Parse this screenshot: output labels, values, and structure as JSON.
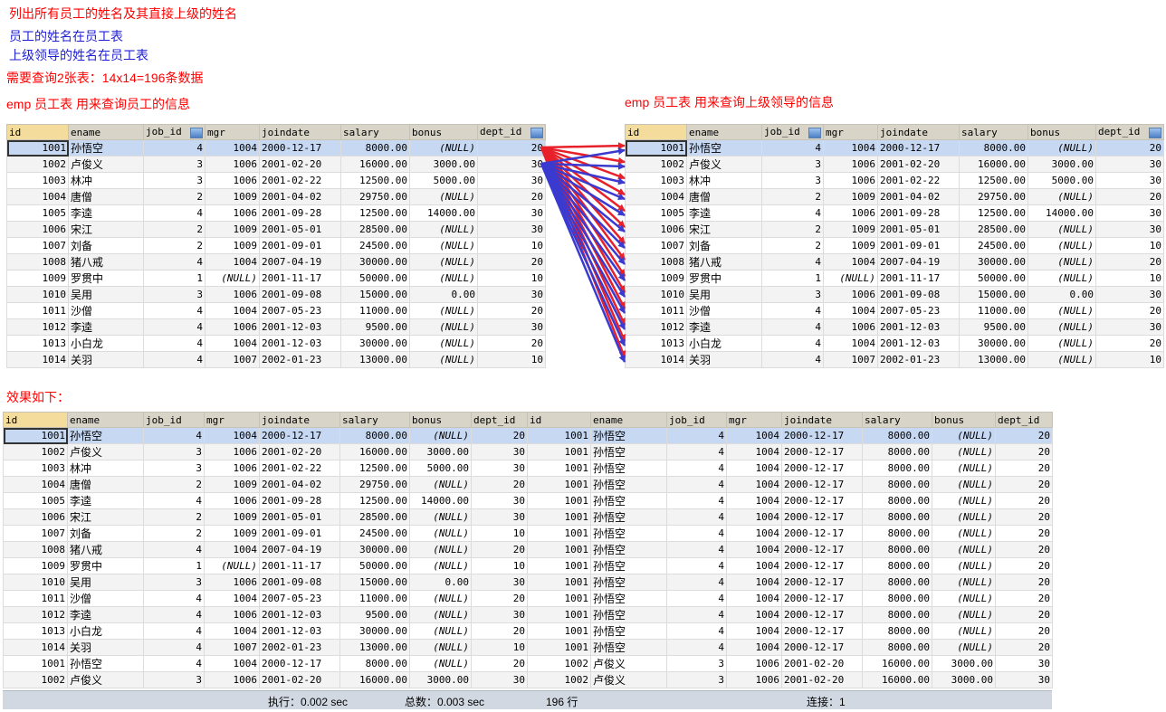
{
  "notes": {
    "line1": "列出所有员工的姓名及其直接上级的姓名",
    "line2": "员工的姓名在员工表",
    "line3": "上级领导的姓名在员工表",
    "line4": "需要查询2张表：14x14=196条数据",
    "left_caption": "emp 员工表  用来查询员工的信息",
    "right_caption": "emp 员工表  用来查询上级领导的信息",
    "result_caption": "效果如下："
  },
  "columns": [
    "id",
    "ename",
    "job_id",
    "mgr",
    "joindate",
    "salary",
    "bonus",
    "dept_id"
  ],
  "emp_rows": [
    [
      "1001",
      "孙悟空",
      "4",
      "1004",
      "2000-12-17",
      "8000.00",
      "(NULL)",
      "20"
    ],
    [
      "1002",
      "卢俊义",
      "3",
      "1006",
      "2001-02-20",
      "16000.00",
      "3000.00",
      "30"
    ],
    [
      "1003",
      "林冲",
      "3",
      "1006",
      "2001-02-22",
      "12500.00",
      "5000.00",
      "30"
    ],
    [
      "1004",
      "唐僧",
      "2",
      "1009",
      "2001-04-02",
      "29750.00",
      "(NULL)",
      "20"
    ],
    [
      "1005",
      "李逵",
      "4",
      "1006",
      "2001-09-28",
      "12500.00",
      "14000.00",
      "30"
    ],
    [
      "1006",
      "宋江",
      "2",
      "1009",
      "2001-05-01",
      "28500.00",
      "(NULL)",
      "30"
    ],
    [
      "1007",
      "刘备",
      "2",
      "1009",
      "2001-09-01",
      "24500.00",
      "(NULL)",
      "10"
    ],
    [
      "1008",
      "猪八戒",
      "4",
      "1004",
      "2007-04-19",
      "30000.00",
      "(NULL)",
      "20"
    ],
    [
      "1009",
      "罗贯中",
      "1",
      "(NULL)",
      "2001-11-17",
      "50000.00",
      "(NULL)",
      "10"
    ],
    [
      "1010",
      "吴用",
      "3",
      "1006",
      "2001-09-08",
      "15000.00",
      "0.00",
      "30"
    ],
    [
      "1011",
      "沙僧",
      "4",
      "1004",
      "2007-05-23",
      "11000.00",
      "(NULL)",
      "20"
    ],
    [
      "1012",
      "李逵",
      "4",
      "1006",
      "2001-12-03",
      "9500.00",
      "(NULL)",
      "30"
    ],
    [
      "1013",
      "小白龙",
      "4",
      "1004",
      "2001-12-03",
      "30000.00",
      "(NULL)",
      "20"
    ],
    [
      "1014",
      "关羽",
      "4",
      "1007",
      "2002-01-23",
      "13000.00",
      "(NULL)",
      "10"
    ]
  ],
  "result_rows": [
    [
      "1001",
      "孙悟空",
      "4",
      "1004",
      "2000-12-17",
      "8000.00",
      "(NULL)",
      "20",
      "1001",
      "孙悟空",
      "4",
      "1004",
      "2000-12-17",
      "8000.00",
      "(NULL)",
      "20"
    ],
    [
      "1002",
      "卢俊义",
      "3",
      "1006",
      "2001-02-20",
      "16000.00",
      "3000.00",
      "30",
      "1001",
      "孙悟空",
      "4",
      "1004",
      "2000-12-17",
      "8000.00",
      "(NULL)",
      "20"
    ],
    [
      "1003",
      "林冲",
      "3",
      "1006",
      "2001-02-22",
      "12500.00",
      "5000.00",
      "30",
      "1001",
      "孙悟空",
      "4",
      "1004",
      "2000-12-17",
      "8000.00",
      "(NULL)",
      "20"
    ],
    [
      "1004",
      "唐僧",
      "2",
      "1009",
      "2001-04-02",
      "29750.00",
      "(NULL)",
      "20",
      "1001",
      "孙悟空",
      "4",
      "1004",
      "2000-12-17",
      "8000.00",
      "(NULL)",
      "20"
    ],
    [
      "1005",
      "李逵",
      "4",
      "1006",
      "2001-09-28",
      "12500.00",
      "14000.00",
      "30",
      "1001",
      "孙悟空",
      "4",
      "1004",
      "2000-12-17",
      "8000.00",
      "(NULL)",
      "20"
    ],
    [
      "1006",
      "宋江",
      "2",
      "1009",
      "2001-05-01",
      "28500.00",
      "(NULL)",
      "30",
      "1001",
      "孙悟空",
      "4",
      "1004",
      "2000-12-17",
      "8000.00",
      "(NULL)",
      "20"
    ],
    [
      "1007",
      "刘备",
      "2",
      "1009",
      "2001-09-01",
      "24500.00",
      "(NULL)",
      "10",
      "1001",
      "孙悟空",
      "4",
      "1004",
      "2000-12-17",
      "8000.00",
      "(NULL)",
      "20"
    ],
    [
      "1008",
      "猪八戒",
      "4",
      "1004",
      "2007-04-19",
      "30000.00",
      "(NULL)",
      "20",
      "1001",
      "孙悟空",
      "4",
      "1004",
      "2000-12-17",
      "8000.00",
      "(NULL)",
      "20"
    ],
    [
      "1009",
      "罗贯中",
      "1",
      "(NULL)",
      "2001-11-17",
      "50000.00",
      "(NULL)",
      "10",
      "1001",
      "孙悟空",
      "4",
      "1004",
      "2000-12-17",
      "8000.00",
      "(NULL)",
      "20"
    ],
    [
      "1010",
      "吴用",
      "3",
      "1006",
      "2001-09-08",
      "15000.00",
      "0.00",
      "30",
      "1001",
      "孙悟空",
      "4",
      "1004",
      "2000-12-17",
      "8000.00",
      "(NULL)",
      "20"
    ],
    [
      "1011",
      "沙僧",
      "4",
      "1004",
      "2007-05-23",
      "11000.00",
      "(NULL)",
      "20",
      "1001",
      "孙悟空",
      "4",
      "1004",
      "2000-12-17",
      "8000.00",
      "(NULL)",
      "20"
    ],
    [
      "1012",
      "李逵",
      "4",
      "1006",
      "2001-12-03",
      "9500.00",
      "(NULL)",
      "30",
      "1001",
      "孙悟空",
      "4",
      "1004",
      "2000-12-17",
      "8000.00",
      "(NULL)",
      "20"
    ],
    [
      "1013",
      "小白龙",
      "4",
      "1004",
      "2001-12-03",
      "30000.00",
      "(NULL)",
      "20",
      "1001",
      "孙悟空",
      "4",
      "1004",
      "2000-12-17",
      "8000.00",
      "(NULL)",
      "20"
    ],
    [
      "1014",
      "关羽",
      "4",
      "1007",
      "2002-01-23",
      "13000.00",
      "(NULL)",
      "10",
      "1001",
      "孙悟空",
      "4",
      "1004",
      "2000-12-17",
      "8000.00",
      "(NULL)",
      "20"
    ],
    [
      "1001",
      "孙悟空",
      "4",
      "1004",
      "2000-12-17",
      "8000.00",
      "(NULL)",
      "20",
      "1002",
      "卢俊义",
      "3",
      "1006",
      "2001-02-20",
      "16000.00",
      "3000.00",
      "30"
    ],
    [
      "1002",
      "卢俊义",
      "3",
      "1006",
      "2001-02-20",
      "16000.00",
      "3000.00",
      "30",
      "1002",
      "卢俊义",
      "3",
      "1006",
      "2001-02-20",
      "16000.00",
      "3000.00",
      "30"
    ]
  ],
  "status": {
    "exec": "执行：0.002 sec",
    "total": "总数：0.003 sec",
    "rows": "196 行",
    "conn": "连接：1"
  },
  "colors": {
    "note_red": "#ff0000",
    "note_blue": "#1f1fd6",
    "arrow_red": "#e8202a",
    "arrow_blue": "#3a3ad0",
    "selected_row": "#c7d8f2"
  }
}
